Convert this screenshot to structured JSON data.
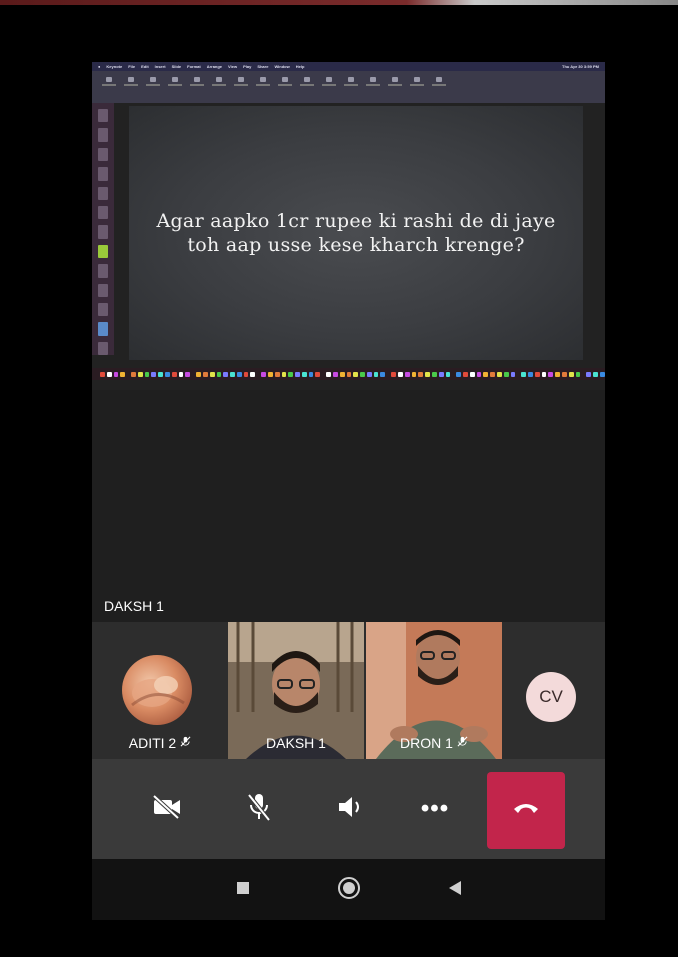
{
  "shared_screen": {
    "menubar": {
      "items": [
        "Keynote",
        "File",
        "Edit",
        "Insert",
        "Slide",
        "Format",
        "Arrange",
        "View",
        "Play",
        "Share",
        "Window",
        "Help"
      ],
      "status": "Thu Apr 30  3:59 PM"
    },
    "slide_text": "Agar aapko 1cr rupee ki rashi de di jaye toh aap usse kese kharch krenge?"
  },
  "active_speaker": "DAKSH 1",
  "participants": [
    {
      "name": "ADITI 2",
      "muted": true,
      "type": "avatar"
    },
    {
      "name": "DAKSH 1",
      "muted": false,
      "type": "video",
      "active": true
    },
    {
      "name": "DRON 1",
      "muted": true,
      "type": "video"
    },
    {
      "initials": "CV",
      "type": "initials"
    }
  ],
  "controls": {
    "camera": "camera-off-icon",
    "mic": "mic-off-icon",
    "speaker": "speaker-icon",
    "more": "•••",
    "end_call": "end-call-icon"
  },
  "colors": {
    "end_call": "#c2254b",
    "active_tile_border": "#4f6bd8",
    "cv_avatar_bg": "#f3dada"
  }
}
